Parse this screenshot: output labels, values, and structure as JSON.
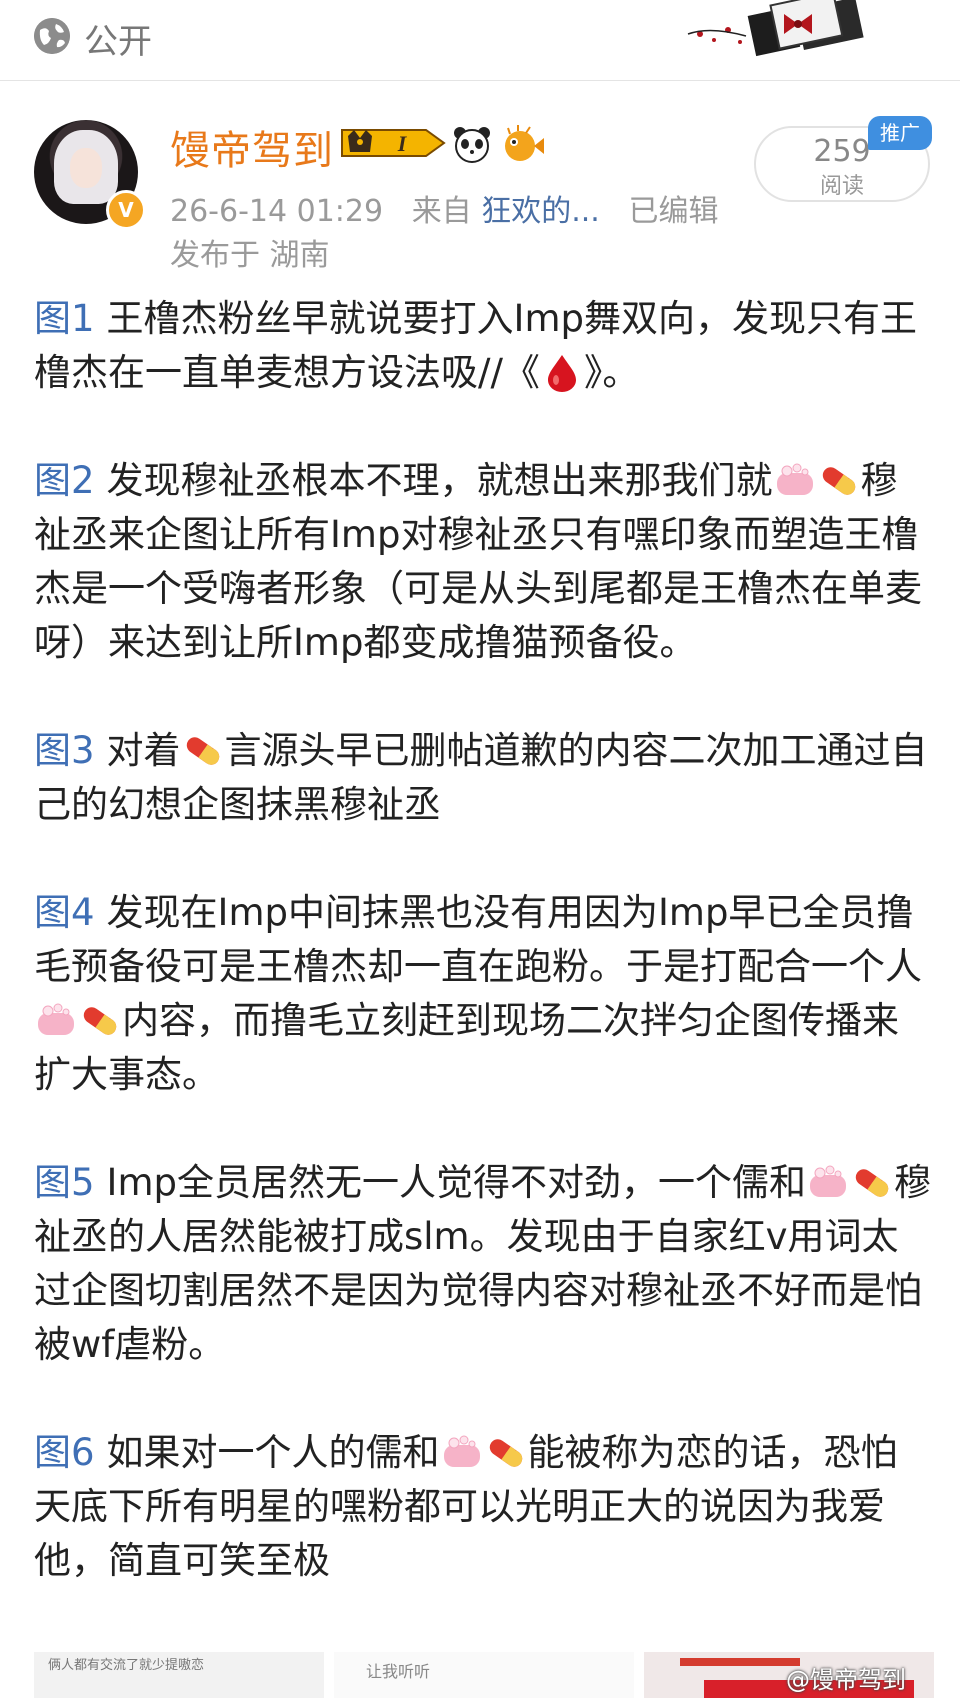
{
  "topbar": {
    "visibility_label": "公开"
  },
  "post": {
    "username": "馒帝驾到",
    "level_badge": "I",
    "timestamp": "26-6-14 01:29",
    "source_prefix": "来自",
    "source_name": "狂欢的...",
    "edited": "已编辑",
    "location": "发布于 湖南",
    "read_count": "259",
    "read_label": "阅读",
    "promo_tag": "推广"
  },
  "paragraphs": [
    {
      "fig": "图1",
      "segments": [
        "王橹杰粉丝早就说要打入Imp舞双向，发现只有王橹杰在一直单麦想方设法吸//《",
        "》。"
      ]
    },
    {
      "fig": "图2",
      "segments": [
        "发现穆祉丞根本不理，就想出来那我们就",
        "",
        "穆祉丞来企图让所有Imp对穆祉丞只有嘿印象而塑造王橹杰是一个受嗨者形象（可是从头到尾都是王橹杰在单麦呀）来达到让所Imp都变成撸猫预备役。"
      ]
    },
    {
      "fig": "图3",
      "segments": [
        "对着",
        "言源头早已删帖道歉的内容二次加工通过自己的幻想企图抹黑穆祉丞"
      ]
    },
    {
      "fig": "图4",
      "segments": [
        "发现在Imp中间抹黑也没有用因为Imp早已全员撸毛预备役可是王橹杰却一直在跑粉。于是打配合一个人",
        "",
        "内容，而撸毛立刻赶到现场二次拌匀企图传播来扩大事态。"
      ]
    },
    {
      "fig": "图5",
      "segments": [
        "Imp全员居然无一人觉得不对劲，一个儒和",
        "",
        "穆祉丞的人居然能被打成slm。发现由于自家红v用词太过企图切割居然不是因为觉得内容对穆祉丞不好而是怕被wf虐粉。"
      ]
    },
    {
      "fig": "图6",
      "segments": [
        "如果对一个人的儒和",
        "",
        "能被称为恋的话，恐怕天底下所有明星的嘿粉都可以光明正大的说因为我爱他，简直可笑至极"
      ]
    }
  ],
  "thumbnails": {
    "thumb1_text": "俩人都有交流了就少提嗷恋",
    "thumb2_text": "让我听听"
  },
  "watermark": "@馒帝驾到",
  "colors": {
    "username": "#e8791a",
    "fig_label": "#3f6fb5",
    "source_link": "#4a6fa5",
    "promo": "#3f8fe0"
  }
}
